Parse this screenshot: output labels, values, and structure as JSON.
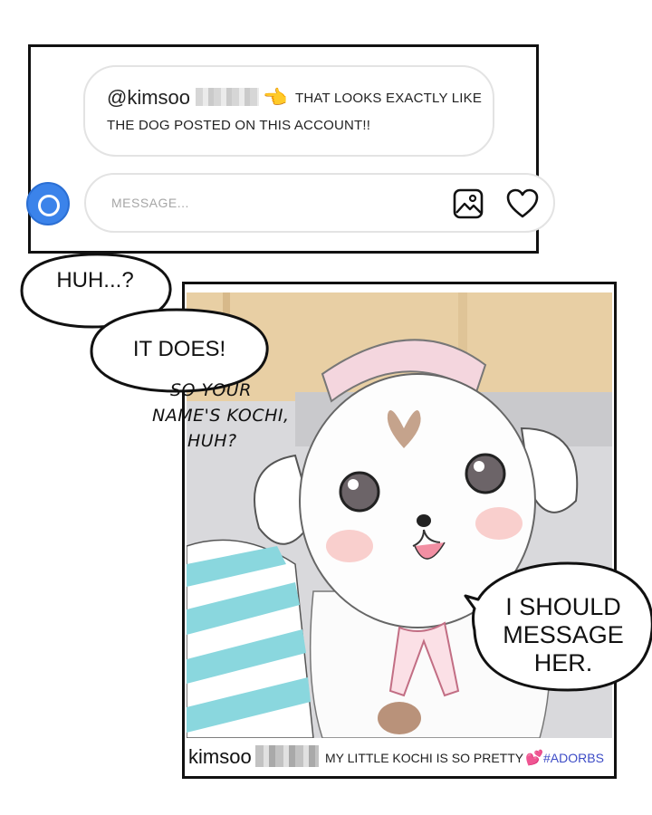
{
  "chat": {
    "comment_handle": "@kimsoo",
    "comment_line1": "THAT LOOKS EXACTLY LIKE",
    "comment_line2": "THE DOG POSTED ON THIS ACCOUNT!!",
    "pointing_icon": "pointing-hand-icon",
    "message_placeholder": "MESSAGE..."
  },
  "speech": {
    "bubble1": "HUH...?",
    "bubble2": "IT DOES!",
    "handwritten": [
      "SO YOUR",
      "NAME'S KOCHI,",
      "HUH?"
    ],
    "bubble3": [
      "I SHOULD",
      "MESSAGE",
      "HER."
    ]
  },
  "post": {
    "username": "kimsoo",
    "caption": "MY LITTLE KOCHI IS SO PRETTY",
    "caption_icon": "two-hearts-icon",
    "hashtag": "#ADORBS"
  },
  "colors": {
    "camera": "#3b83ea",
    "hashtag": "#3c4bc6",
    "heart_emoji": "#e83e9d",
    "wall": "#e8cfa4",
    "sofa": "#d9d9dc",
    "pillow_stripe": "#8ad7de"
  }
}
